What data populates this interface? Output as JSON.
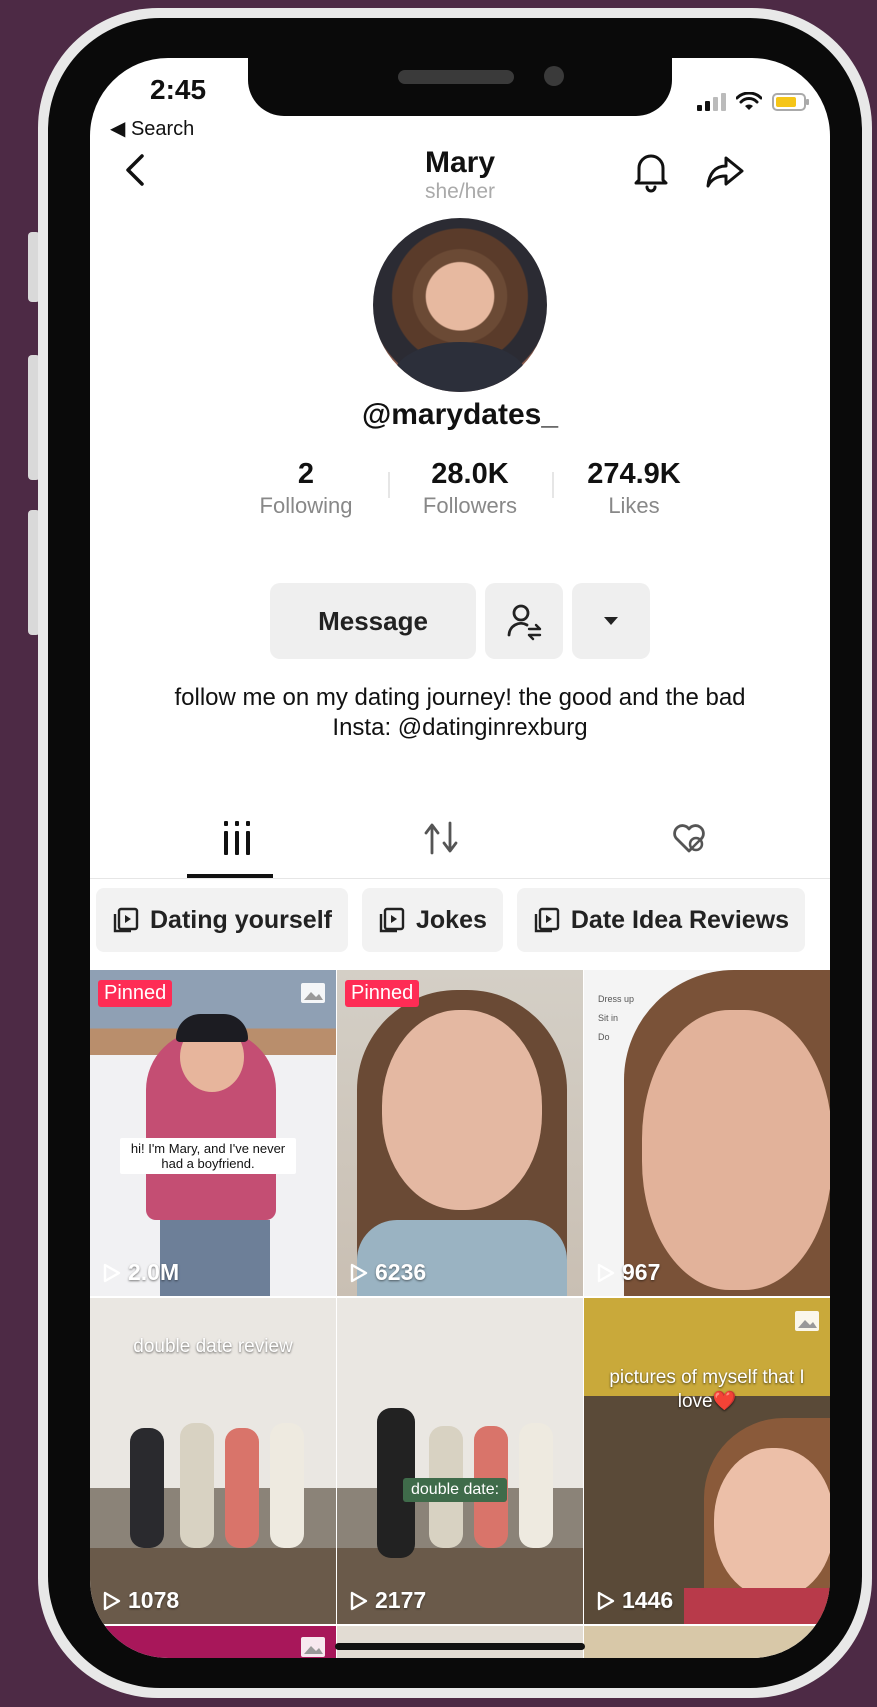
{
  "status": {
    "time": "2:45",
    "back_label": "◀ Search"
  },
  "header": {
    "name": "Mary",
    "pronouns": "she/her"
  },
  "profile": {
    "username": "@marydates_"
  },
  "stats": [
    {
      "value": "2",
      "label": "Following"
    },
    {
      "value": "28.0K",
      "label": "Followers"
    },
    {
      "value": "274.9K",
      "label": "Likes"
    }
  ],
  "actions": {
    "message_label": "Message"
  },
  "bio": {
    "line1": "follow me on my dating journey! the good and the bad",
    "line2": "Insta: @datinginrexburg"
  },
  "playlists": [
    "Dating yourself",
    "Jokes",
    "Date Idea Reviews"
  ],
  "videos": [
    {
      "pinned": "Pinned",
      "views": "2.0M",
      "caption": "hi! I'm Mary, and I've never had a boyfriend."
    },
    {
      "pinned": "Pinned",
      "views": "6236"
    },
    {
      "views": "967",
      "notes": [
        "Dress up",
        "Sit in",
        "Do"
      ]
    },
    {
      "views": "1078",
      "caption": "double date review"
    },
    {
      "views": "2177",
      "caption": "double date:"
    },
    {
      "views": "1446",
      "caption": "pictures of myself that I love❤️"
    }
  ],
  "colors": {
    "accent": "#fe2c55",
    "background": "#4d2a45"
  }
}
